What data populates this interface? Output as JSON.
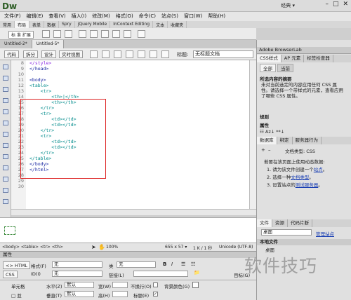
{
  "app": {
    "logo": "Dw",
    "workspace": "经典 ▾"
  },
  "menu": [
    "文件(F)",
    "编辑(E)",
    "查看(V)",
    "插入(I)",
    "修改(M)",
    "格式(O)",
    "命令(C)",
    "站点(S)",
    "窗口(W)",
    "帮助(H)"
  ],
  "insert_tabs": [
    "常用",
    "布局",
    "表单",
    "数据",
    "Spry",
    "jQuery Mobile",
    "InContext Editing",
    "文本",
    "收藏夹"
  ],
  "insert_row_label": "标 准  扩展",
  "doc_tabs": [
    "Untitled-2*",
    "Untitled-5*"
  ],
  "doc_toolbar": {
    "buttons": [
      "代码",
      "拆分",
      "设计",
      "实时视图"
    ],
    "title_label": "标题:",
    "title_value": "无标题文档"
  },
  "code": {
    "line_numbers": [
      "8",
      "9",
      "10",
      "11",
      "12",
      "13",
      "14",
      "15",
      "16",
      "17",
      "18",
      "19",
      "20",
      "21",
      "22",
      "23",
      "24",
      "25",
      "26",
      "27",
      "28",
      "29",
      "30"
    ],
    "lines": [
      {
        "t": "</style>",
        "c": "purple"
      },
      {
        "t": "</head>",
        "c": "blue"
      },
      {
        "t": "",
        "c": "blue"
      },
      {
        "t": "<body>",
        "c": "blue"
      },
      {
        "t": "<table>",
        "c": "teal"
      },
      {
        "t": "    <tr>",
        "c": "teal"
      },
      {
        "t": "        <th>|</th>",
        "c": "teal"
      },
      {
        "t": "        <th></th>",
        "c": "teal"
      },
      {
        "t": "    </tr>",
        "c": "teal"
      },
      {
        "t": "    <tr>",
        "c": "teal"
      },
      {
        "t": "        <td></td>",
        "c": "teal"
      },
      {
        "t": "        <td></td>",
        "c": "teal"
      },
      {
        "t": "    </tr>",
        "c": "teal"
      },
      {
        "t": "    <tr>",
        "c": "teal"
      },
      {
        "t": "        <td></td>",
        "c": "teal"
      },
      {
        "t": "        <td></td>",
        "c": "teal"
      },
      {
        "t": "    </tr>",
        "c": "teal"
      },
      {
        "t": "</table>",
        "c": "teal"
      },
      {
        "t": "</body>",
        "c": "blue"
      },
      {
        "t": "</html>",
        "c": "blue"
      },
      {
        "t": "",
        "c": "blue"
      },
      {
        "t": "",
        "c": "blue"
      },
      {
        "t": "",
        "c": "blue"
      }
    ]
  },
  "status": {
    "path": "<body> <table> <tr> <th>",
    "zoom": "100%",
    "size": "655 x 57 ▾",
    "weight": "1 K / 1 秒",
    "encoding": "Unicode (UTF-8)"
  },
  "properties": {
    "title": "属性",
    "html_btn": "<> HTML",
    "css_btn": "CSS",
    "format_label": "格式(F)",
    "format_value": "无",
    "class_label": "类",
    "class_value": "无",
    "id_label": "ID(I)",
    "id_value": "无",
    "link_label": "链接(L)",
    "target_label": "目标(G)",
    "cell_label": "单元格",
    "horz_label": "水平(Z)",
    "horz_value": "默认",
    "vert_label": "垂直(T)",
    "vert_value": "默认",
    "w_label": "宽(W)",
    "h_label": "高(H)",
    "nowrap_label": "不换行(O)",
    "header_label": "标题(E)",
    "bg_label": "背景颜色(G)"
  },
  "right_panel": {
    "browserlab": "Adobe BrowserLab",
    "css_tabs": [
      "CSS样式",
      "AP 元素",
      "标签检查器"
    ],
    "mode_tabs": [
      "全部",
      "当前"
    ],
    "summary_head": "所选内容的摘要",
    "summary_text": "未对当前选定的内容应用任何 CSS 属性。请选择一个带样式的元素，查看应用了哪些 CSS 属性。",
    "rules": "规则",
    "props": "属性",
    "db_tabs": [
      "数据库",
      "绑定",
      "服务器行为"
    ],
    "doc_type": "文档类型: CSS",
    "instr_head": "若要在该页面上使用动态数据:",
    "steps": [
      "1. 请为该文件创建一个",
      "2. 选择一种",
      "3. 设置站点的"
    ],
    "step_links": [
      "站点",
      "文档类型",
      "测试服务器"
    ],
    "files_tabs": [
      "文件",
      "资源",
      "代码片断"
    ],
    "desktop": "桌面",
    "manage": "管理站点",
    "local_files": "本地文件",
    "desktop2": "桌面"
  },
  "watermark": "软件技巧"
}
